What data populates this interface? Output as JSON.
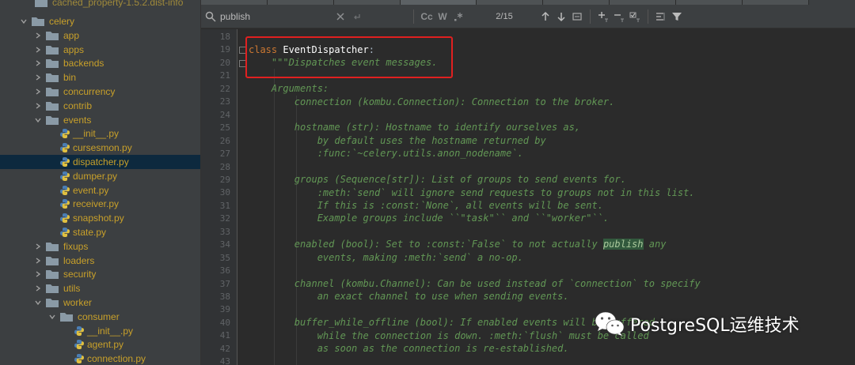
{
  "sidebar": {
    "top_partial_label": "cached_property-1.5.2.dist-info",
    "items": [
      {
        "label": "celery",
        "kind": "folder",
        "level": 0,
        "expanded": true
      },
      {
        "label": "app",
        "kind": "folder",
        "level": 1,
        "expanded": false
      },
      {
        "label": "apps",
        "kind": "folder",
        "level": 1,
        "expanded": false
      },
      {
        "label": "backends",
        "kind": "folder",
        "level": 1,
        "expanded": false
      },
      {
        "label": "bin",
        "kind": "folder",
        "level": 1,
        "expanded": false
      },
      {
        "label": "concurrency",
        "kind": "folder",
        "level": 1,
        "expanded": false
      },
      {
        "label": "contrib",
        "kind": "folder",
        "level": 1,
        "expanded": false
      },
      {
        "label": "events",
        "kind": "folder",
        "level": 1,
        "expanded": true
      },
      {
        "label": "__init__.py",
        "kind": "file",
        "level": 2
      },
      {
        "label": "cursesmon.py",
        "kind": "file",
        "level": 2
      },
      {
        "label": "dispatcher.py",
        "kind": "file",
        "level": 2,
        "selected": true
      },
      {
        "label": "dumper.py",
        "kind": "file",
        "level": 2
      },
      {
        "label": "event.py",
        "kind": "file",
        "level": 2
      },
      {
        "label": "receiver.py",
        "kind": "file",
        "level": 2
      },
      {
        "label": "snapshot.py",
        "kind": "file",
        "level": 2
      },
      {
        "label": "state.py",
        "kind": "file",
        "level": 2
      },
      {
        "label": "fixups",
        "kind": "folder",
        "level": 1,
        "expanded": false
      },
      {
        "label": "loaders",
        "kind": "folder",
        "level": 1,
        "expanded": false
      },
      {
        "label": "security",
        "kind": "folder",
        "level": 1,
        "expanded": false
      },
      {
        "label": "utils",
        "kind": "folder",
        "level": 1,
        "expanded": false
      },
      {
        "label": "worker",
        "kind": "folder",
        "level": 1,
        "expanded": true
      },
      {
        "label": "consumer",
        "kind": "folder",
        "level": 2,
        "expanded": true
      },
      {
        "label": "__init__.py",
        "kind": "file",
        "level": 3
      },
      {
        "label": "agent.py",
        "kind": "file",
        "level": 3
      },
      {
        "label": "connection.py",
        "kind": "file",
        "level": 3
      }
    ]
  },
  "search": {
    "query": "publish",
    "match_count": "2/15",
    "case_label": "Cc",
    "word_label": "W"
  },
  "editor": {
    "line_numbers": [
      "18",
      "19",
      "20",
      "21",
      "22",
      "23",
      "24",
      "25",
      "26",
      "27",
      "28",
      "29",
      "30",
      "31",
      "32",
      "33",
      "34",
      "35",
      "36",
      "37",
      "38",
      "39",
      "40",
      "41",
      "42",
      "43"
    ],
    "lines": {
      "l19_kw": "class",
      "l19_name": " EventDispatcher",
      "l19_colon": ":",
      "l20": "\"\"\"Dispatches event messages.",
      "l22": "Arguments:",
      "l23": "connection (kombu.Connection): Connection to the broker.",
      "l25": "hostname (str): Hostname to identify ourselves as,",
      "l26": "by default uses the hostname returned by",
      "l27": ":func:`~celery.utils.anon_nodename`.",
      "l29": "groups (Sequence[str]): List of groups to send events for.",
      "l30": ":meth:`send` will ignore send requests to groups not in this list.",
      "l31": "If this is :const:`None`, all events will be sent.",
      "l32": "Example groups include ``\"task\"`` and ``\"worker\"``.",
      "l34_pre": "enabled (bool): Set to :const:`False` to not actually ",
      "l34_match": "publish",
      "l34_post": " any",
      "l35": "events, making :meth:`send` a no-op.",
      "l37": "channel (kombu.Channel): Can be used instead of `connection` to specify",
      "l38": "an exact channel to use when sending events.",
      "l40": "buffer_while_offline (bool): If enabled events will be buffered",
      "l41": "while the connection is down. :meth:`flush` must be called",
      "l42": "as soon as the connection is re-established."
    }
  },
  "watermark": {
    "text": "PostgreSQL运维技术"
  },
  "colors": {
    "folder": "#8a9aa6",
    "file_label": "#c8a02a",
    "selected_row": "#0d293e",
    "docstring": "#629755",
    "keyword": "#cc7832",
    "match_bg": "#32593d",
    "highlight_box": "#e02020"
  }
}
